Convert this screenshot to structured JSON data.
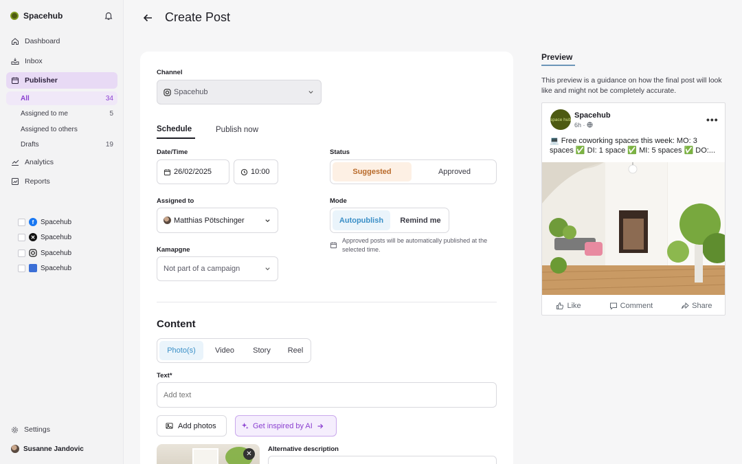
{
  "sidebar": {
    "brand": "Spacehub",
    "nav": {
      "dashboard": "Dashboard",
      "inbox": "Inbox",
      "publisher": "Publisher",
      "analytics": "Analytics",
      "reports": "Reports"
    },
    "publisher_sub": [
      {
        "label": "All",
        "count": "34"
      },
      {
        "label": "Assigned to me",
        "count": "5"
      },
      {
        "label": "Assigned to others",
        "count": ""
      },
      {
        "label": "Drafts",
        "count": "19"
      }
    ],
    "channels": [
      {
        "label": "Spacehub",
        "icon": "facebook-icon"
      },
      {
        "label": "Spacehub",
        "icon": "x-icon"
      },
      {
        "label": "Spacehub",
        "icon": "instagram-icon"
      },
      {
        "label": "Spacehub",
        "icon": "google-business-icon"
      }
    ],
    "settings": "Settings",
    "user": "Susanne Jandovic"
  },
  "header": {
    "title": "Create Post"
  },
  "form": {
    "channel_label": "Channel",
    "channel_value": "Spacehub",
    "schedule_tabs": {
      "schedule": "Schedule",
      "publish_now": "Publish now"
    },
    "datetime_label": "Date/Time",
    "date_value": "26/02/2025",
    "time_value": "10:00",
    "status_label": "Status",
    "status_options": {
      "suggested": "Suggested",
      "approved": "Approved"
    },
    "assigned_label": "Assigned to",
    "assigned_value": "Matthias Pötschinger",
    "mode_label": "Mode",
    "mode_options": {
      "autopublish": "Autopublish",
      "remind": "Remind me"
    },
    "mode_hint": "Approved posts will be automatically published at the selected time.",
    "campaign_label": "Kamapgne",
    "campaign_value": "Not part of a campaign",
    "content_title": "Content",
    "content_tabs": {
      "photos": "Photo(s)",
      "video": "Video",
      "story": "Story",
      "reel": "Reel"
    },
    "text_label": "Text*",
    "text_placeholder": "Add text",
    "add_photos": "Add photos",
    "ai_button": "Get inspired by AI",
    "alt_label": "Alternative description"
  },
  "preview": {
    "tab": "Preview",
    "note": "This preview is a guidance on how the final post will look like and might not be completely accurate.",
    "post_name": "Spacehub",
    "post_logo": "space hub",
    "post_meta": "6h ·",
    "post_text": "💻 Free coworking spaces this week: MO: 3 spaces ✅ DI: 1 space ✅ MI: 5 spaces ✅ DO:...",
    "actions": {
      "like": "Like",
      "comment": "Comment",
      "share": "Share"
    }
  },
  "colors": {
    "accent_purple": "#8a3fd0",
    "suggested_bg": "#fdf0e4",
    "suggested_text": "#b86a2a",
    "autopublish_text": "#3a8fc7"
  }
}
